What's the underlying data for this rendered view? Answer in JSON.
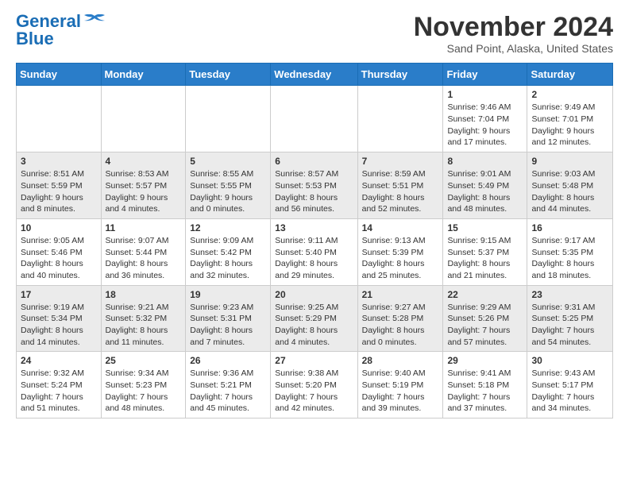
{
  "logo": {
    "line1": "General",
    "line2": "Blue"
  },
  "title": "November 2024",
  "location": "Sand Point, Alaska, United States",
  "weekdays": [
    "Sunday",
    "Monday",
    "Tuesday",
    "Wednesday",
    "Thursday",
    "Friday",
    "Saturday"
  ],
  "weeks": [
    [
      {
        "day": "",
        "info": ""
      },
      {
        "day": "",
        "info": ""
      },
      {
        "day": "",
        "info": ""
      },
      {
        "day": "",
        "info": ""
      },
      {
        "day": "",
        "info": ""
      },
      {
        "day": "1",
        "info": "Sunrise: 9:46 AM\nSunset: 7:04 PM\nDaylight: 9 hours and 17 minutes."
      },
      {
        "day": "2",
        "info": "Sunrise: 9:49 AM\nSunset: 7:01 PM\nDaylight: 9 hours and 12 minutes."
      }
    ],
    [
      {
        "day": "3",
        "info": "Sunrise: 8:51 AM\nSunset: 5:59 PM\nDaylight: 9 hours and 8 minutes."
      },
      {
        "day": "4",
        "info": "Sunrise: 8:53 AM\nSunset: 5:57 PM\nDaylight: 9 hours and 4 minutes."
      },
      {
        "day": "5",
        "info": "Sunrise: 8:55 AM\nSunset: 5:55 PM\nDaylight: 9 hours and 0 minutes."
      },
      {
        "day": "6",
        "info": "Sunrise: 8:57 AM\nSunset: 5:53 PM\nDaylight: 8 hours and 56 minutes."
      },
      {
        "day": "7",
        "info": "Sunrise: 8:59 AM\nSunset: 5:51 PM\nDaylight: 8 hours and 52 minutes."
      },
      {
        "day": "8",
        "info": "Sunrise: 9:01 AM\nSunset: 5:49 PM\nDaylight: 8 hours and 48 minutes."
      },
      {
        "day": "9",
        "info": "Sunrise: 9:03 AM\nSunset: 5:48 PM\nDaylight: 8 hours and 44 minutes."
      }
    ],
    [
      {
        "day": "10",
        "info": "Sunrise: 9:05 AM\nSunset: 5:46 PM\nDaylight: 8 hours and 40 minutes."
      },
      {
        "day": "11",
        "info": "Sunrise: 9:07 AM\nSunset: 5:44 PM\nDaylight: 8 hours and 36 minutes."
      },
      {
        "day": "12",
        "info": "Sunrise: 9:09 AM\nSunset: 5:42 PM\nDaylight: 8 hours and 32 minutes."
      },
      {
        "day": "13",
        "info": "Sunrise: 9:11 AM\nSunset: 5:40 PM\nDaylight: 8 hours and 29 minutes."
      },
      {
        "day": "14",
        "info": "Sunrise: 9:13 AM\nSunset: 5:39 PM\nDaylight: 8 hours and 25 minutes."
      },
      {
        "day": "15",
        "info": "Sunrise: 9:15 AM\nSunset: 5:37 PM\nDaylight: 8 hours and 21 minutes."
      },
      {
        "day": "16",
        "info": "Sunrise: 9:17 AM\nSunset: 5:35 PM\nDaylight: 8 hours and 18 minutes."
      }
    ],
    [
      {
        "day": "17",
        "info": "Sunrise: 9:19 AM\nSunset: 5:34 PM\nDaylight: 8 hours and 14 minutes."
      },
      {
        "day": "18",
        "info": "Sunrise: 9:21 AM\nSunset: 5:32 PM\nDaylight: 8 hours and 11 minutes."
      },
      {
        "day": "19",
        "info": "Sunrise: 9:23 AM\nSunset: 5:31 PM\nDaylight: 8 hours and 7 minutes."
      },
      {
        "day": "20",
        "info": "Sunrise: 9:25 AM\nSunset: 5:29 PM\nDaylight: 8 hours and 4 minutes."
      },
      {
        "day": "21",
        "info": "Sunrise: 9:27 AM\nSunset: 5:28 PM\nDaylight: 8 hours and 0 minutes."
      },
      {
        "day": "22",
        "info": "Sunrise: 9:29 AM\nSunset: 5:26 PM\nDaylight: 7 hours and 57 minutes."
      },
      {
        "day": "23",
        "info": "Sunrise: 9:31 AM\nSunset: 5:25 PM\nDaylight: 7 hours and 54 minutes."
      }
    ],
    [
      {
        "day": "24",
        "info": "Sunrise: 9:32 AM\nSunset: 5:24 PM\nDaylight: 7 hours and 51 minutes."
      },
      {
        "day": "25",
        "info": "Sunrise: 9:34 AM\nSunset: 5:23 PM\nDaylight: 7 hours and 48 minutes."
      },
      {
        "day": "26",
        "info": "Sunrise: 9:36 AM\nSunset: 5:21 PM\nDaylight: 7 hours and 45 minutes."
      },
      {
        "day": "27",
        "info": "Sunrise: 9:38 AM\nSunset: 5:20 PM\nDaylight: 7 hours and 42 minutes."
      },
      {
        "day": "28",
        "info": "Sunrise: 9:40 AM\nSunset: 5:19 PM\nDaylight: 7 hours and 39 minutes."
      },
      {
        "day": "29",
        "info": "Sunrise: 9:41 AM\nSunset: 5:18 PM\nDaylight: 7 hours and 37 minutes."
      },
      {
        "day": "30",
        "info": "Sunrise: 9:43 AM\nSunset: 5:17 PM\nDaylight: 7 hours and 34 minutes."
      }
    ]
  ]
}
